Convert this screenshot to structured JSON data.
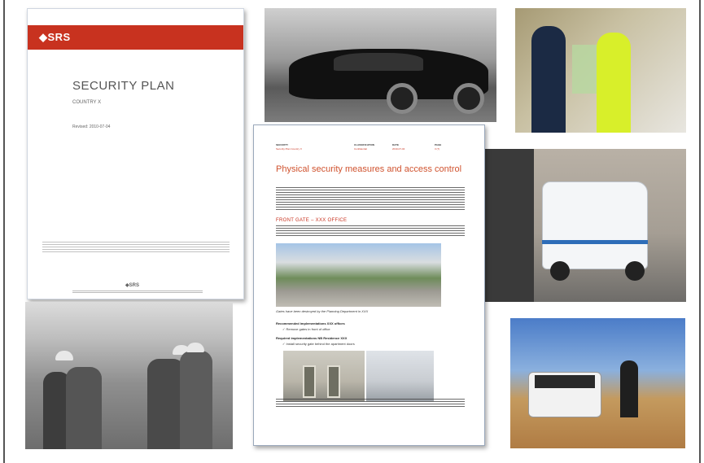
{
  "cover": {
    "logo": "◆SRS",
    "title": "SECURITY PLAN",
    "subtitle": "COUNTRY X",
    "revised": "Revised: 2010-07-04",
    "footer_logo": "◆SRS",
    "brand_color": "#c8321f"
  },
  "report_page": {
    "meta": [
      {
        "label": "SECURITY",
        "value": "Security Plan Country X"
      },
      {
        "label": "CLASSIFICATION",
        "value": "Confidential"
      },
      {
        "label": "DATE",
        "value": "2010-07-04"
      },
      {
        "label": "PAGE",
        "value": "3 (7)"
      }
    ],
    "heading": "Physical security measures and access control",
    "section_title": "FRONT GATE – XXX OFFICE",
    "photo_caption": "Gates have been destroyed by the Planning Department in XXX",
    "recommended_title": "Recommended implementations XXX offices",
    "recommended_item": "Remove gates in front of office",
    "required_title": "Required implementations NB Residence XXX",
    "required_item": "Install security gate behind the apartment doors",
    "accent_color": "#d0532f"
  },
  "photos": [
    {
      "name": "black sedan"
    },
    {
      "name": "security guard screening"
    },
    {
      "name": "ambulance"
    },
    {
      "name": "field site inspection"
    },
    {
      "name": "white suv on hillside"
    }
  ]
}
